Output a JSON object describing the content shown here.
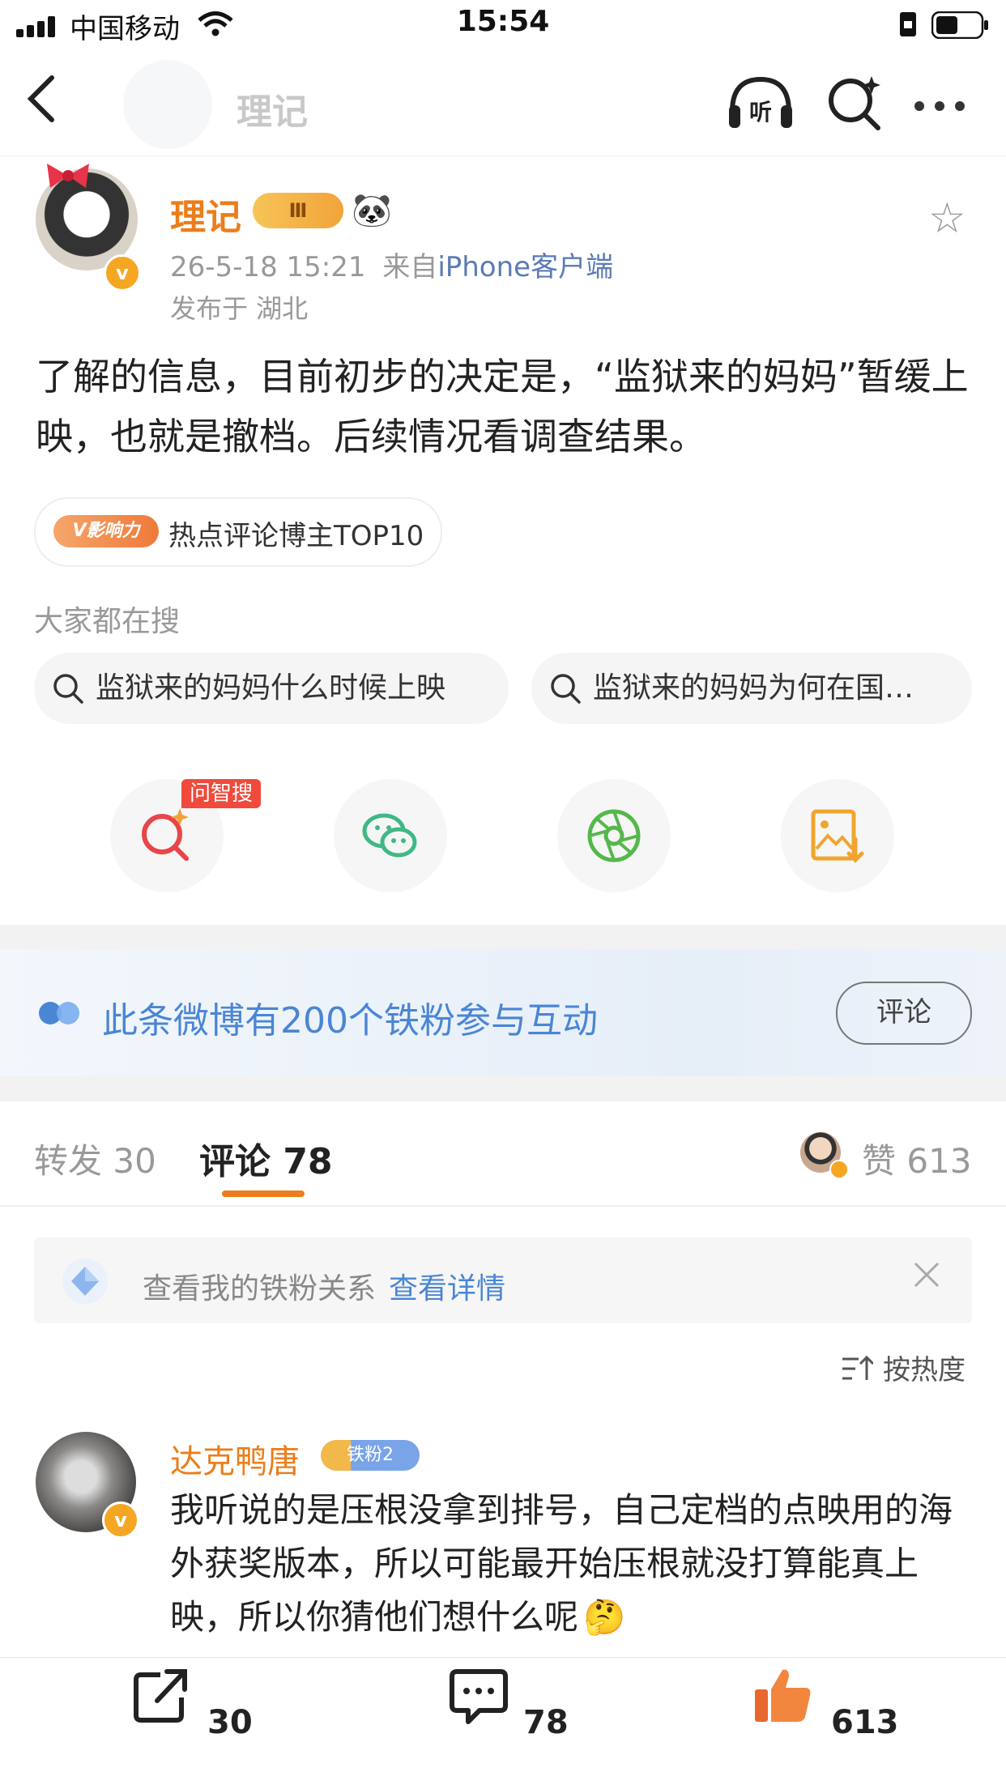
{
  "status_bar": {
    "carrier": "中国移动",
    "time": "15:54"
  },
  "nav": {
    "title": "理记"
  },
  "post": {
    "author": "理记",
    "level_badge": "Ⅲ",
    "timestamp": "26-5-18 15:21",
    "from_prefix": "来自",
    "source": "iPhone客户端",
    "location": "发布于 湖北",
    "text": "了解的信息，目前初步的决定是，“监狱来的妈妈”暂缓上映，也就是撤档。后续情况看调查结果。",
    "tag_badge": "V影响力",
    "tag_text": "热点评论博主TOP10"
  },
  "search": {
    "heading": "大家都在搜",
    "suggestions": [
      "监狱来的妈妈什么时候上映",
      "监狱来的妈妈为何在国…"
    ]
  },
  "share": {
    "wen_badge": "问智搜"
  },
  "fans_banner": {
    "text": "此条微博有200个铁粉参与互动",
    "button": "评论"
  },
  "tabs": {
    "repost": "转发 30",
    "comment": "评论 78",
    "like": "赞 613"
  },
  "ironfan": {
    "text": "查看我的铁粉关系",
    "link": "查看详情"
  },
  "sort": {
    "label": "按热度"
  },
  "comment": {
    "name": "达克鸭唐",
    "badge": "铁粉2",
    "text": "我听说的是压根没拿到排号，自己定档的点映用的海外获奖版本，所以可能最开始压根就没打算能真上映，所以你猜他们想什么呢"
  },
  "bottom_bar": {
    "repost_count": "30",
    "comment_count": "78",
    "like_count": "613"
  },
  "colors": {
    "accent": "#ec7d1a",
    "link": "#4a86d4",
    "gray": "#999999"
  }
}
